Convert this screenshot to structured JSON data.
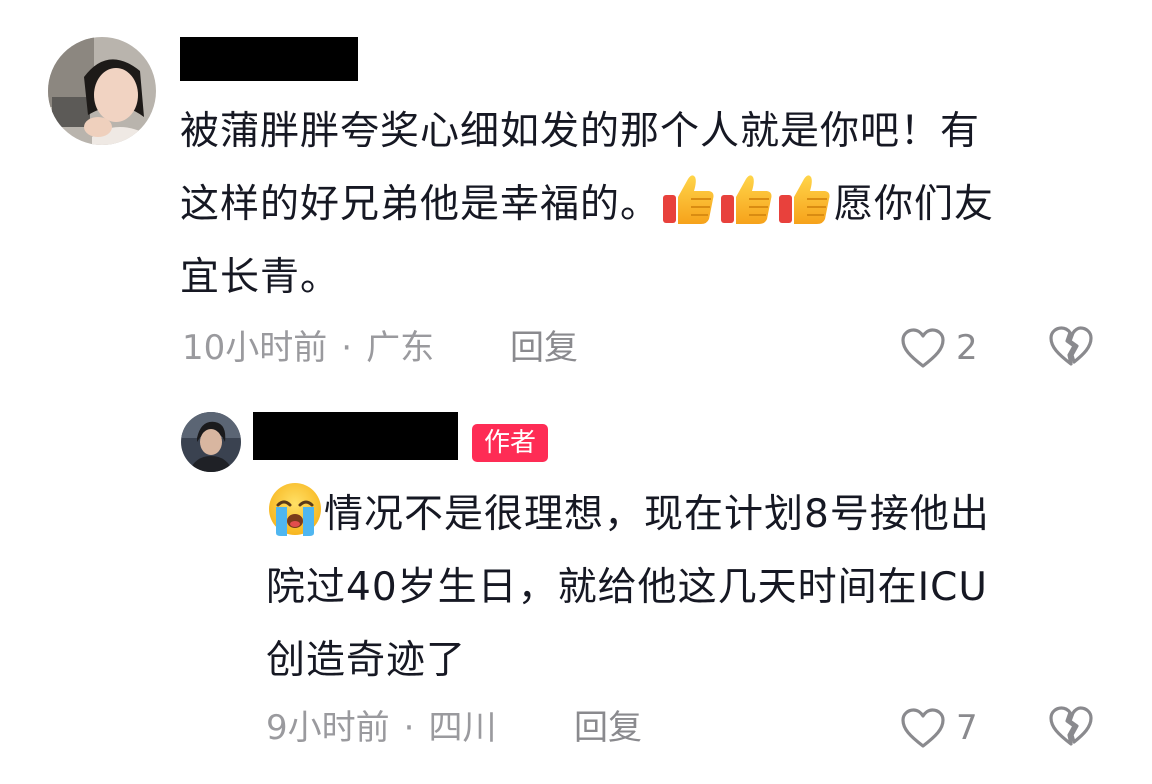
{
  "comments": [
    {
      "lines": [
        [
          "被蒲胖胖夸奖心细如发的那个人就是你吧！有"
        ],
        [
          "这样的好兄弟他是幸福的。",
          "thumbs-up-icon",
          "thumbs-up-icon",
          "thumbs-up-icon",
          "愿你们友"
        ],
        [
          "宜长青。"
        ]
      ],
      "time": "10小时前",
      "separator": "·",
      "location": "广东",
      "reply_label": "回复",
      "like_count": "2"
    },
    {
      "author_badge": "作者",
      "lines": [
        [
          "loudly-crying-face-icon",
          "情况不是很理想，现在计划8号接他出"
        ],
        [
          "院过40岁生日，就给他这几天时间在ICU"
        ],
        [
          "创造奇迹了"
        ]
      ],
      "time": "9小时前",
      "separator": "·",
      "location": "四川",
      "reply_label": "回复",
      "like_count": "7"
    }
  ],
  "colors": {
    "text": "#161823",
    "meta": "#9a9a9e",
    "badge": "#fe2c55"
  }
}
